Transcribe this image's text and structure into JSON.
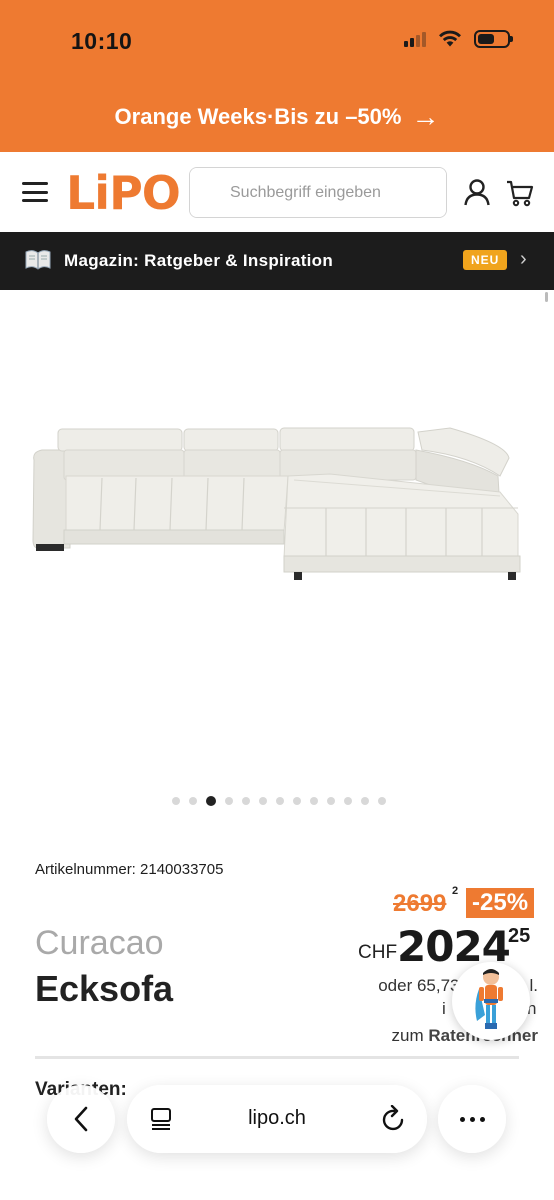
{
  "status_bar": {
    "time": "10:10"
  },
  "promo": {
    "text": "Orange Weeks·Bis zu –50%",
    "arrow": "→"
  },
  "header": {
    "logo": "LiPO",
    "search_placeholder": "Suchbegriff eingeben",
    "brand_color": "#ee7a31"
  },
  "magazine": {
    "label": "Magazin: Ratgeber & Inspiration",
    "badge": "NEU",
    "chevron": "›"
  },
  "gallery": {
    "image_count": 13,
    "active_index": 2,
    "subject": "sofa-image"
  },
  "product": {
    "article_label": "Artikelnummer: 2140033705",
    "brand": "Curacao",
    "name": "Ecksofa",
    "old_price": "2699",
    "old_price_sup": "2",
    "discount": "-25%",
    "currency": "CHF",
    "price": "2024",
    "price_cents": "25",
    "installment_line1": "oder 65,73",
    "installment_line1_end": "l.",
    "installment_line2_start": "i",
    "installment_line2_end": "n",
    "rate_prefix": "zum ",
    "rate_link": "Ratenrechner",
    "variants_label": "Varianten:"
  },
  "browser": {
    "url": "lipo.ch"
  }
}
